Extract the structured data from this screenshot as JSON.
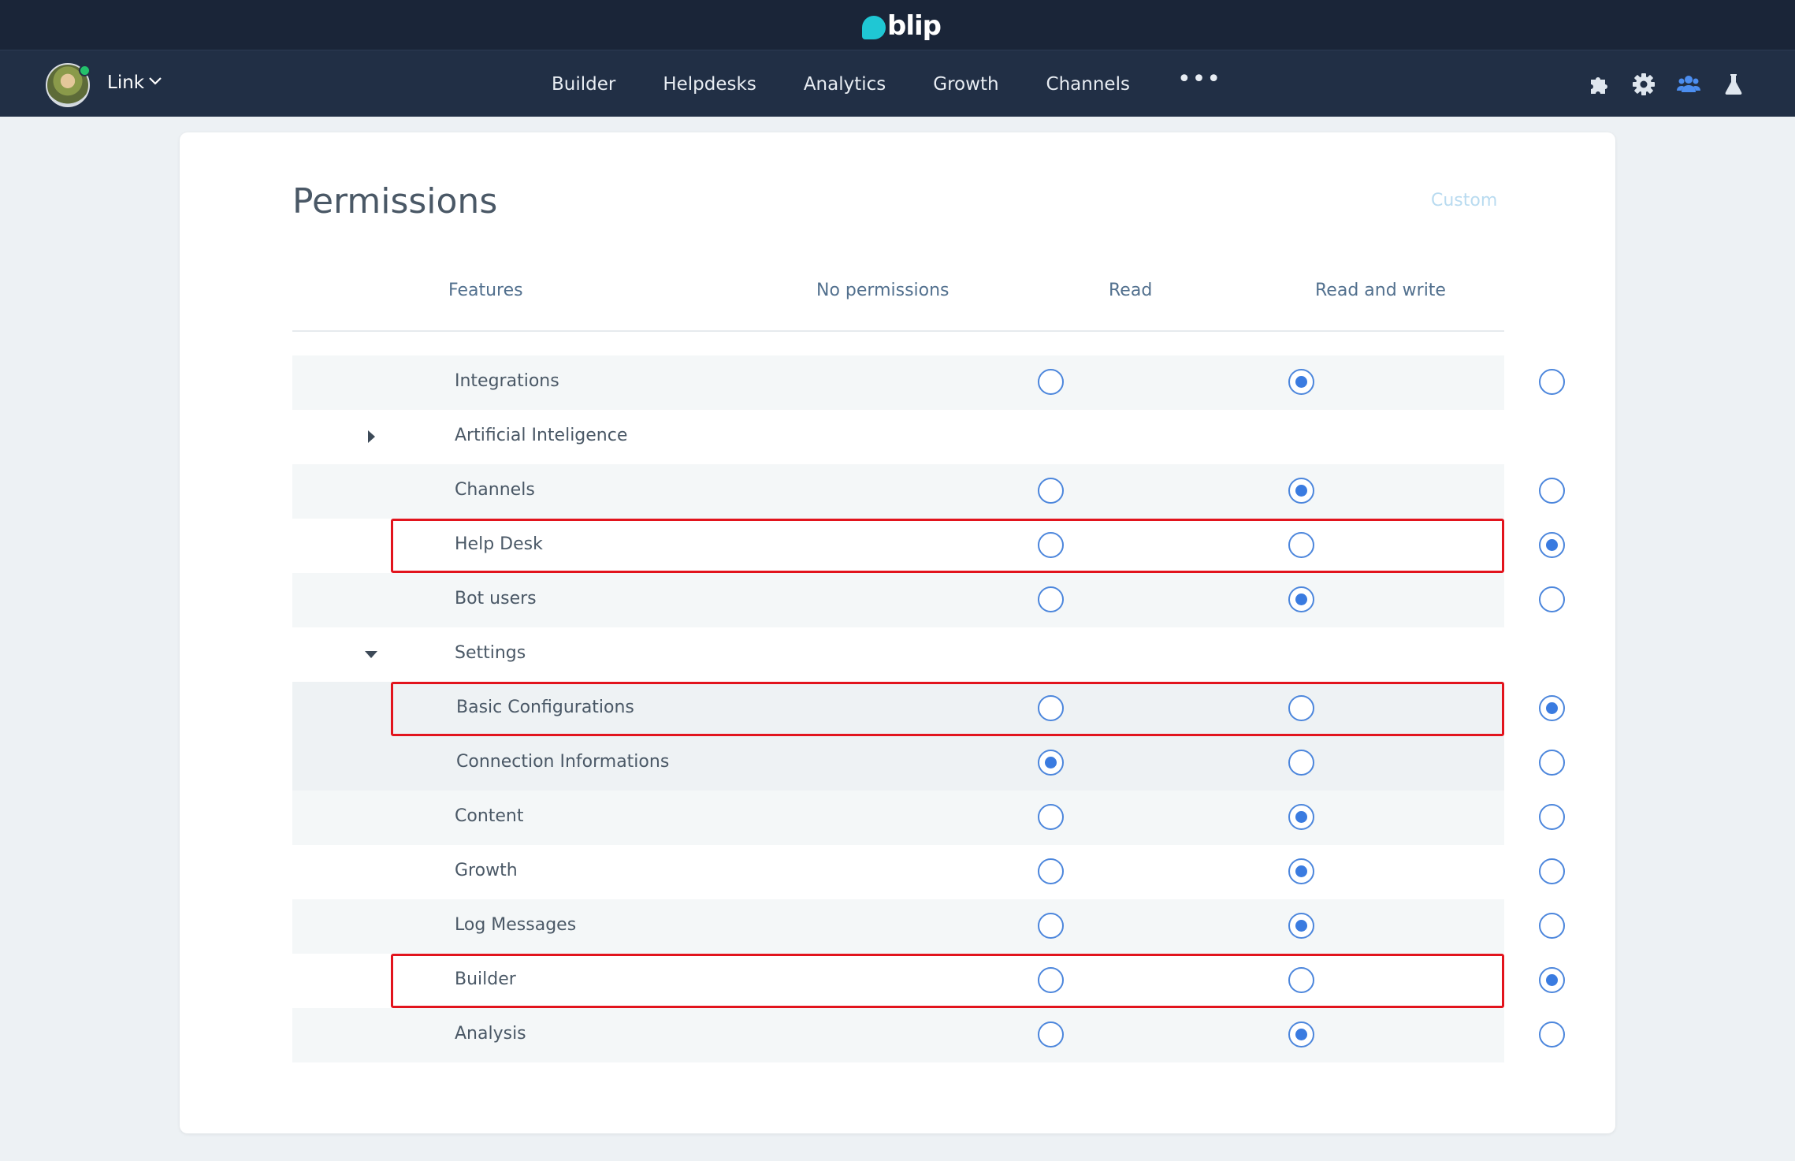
{
  "brand": {
    "name": "blip"
  },
  "user": {
    "name": "Link"
  },
  "nav": {
    "links": [
      "Builder",
      "Helpdesks",
      "Analytics",
      "Growth",
      "Channels"
    ],
    "more": "•••",
    "icons": [
      "puzzle-icon",
      "gear-icon",
      "team-icon",
      "flask-icon"
    ],
    "active_icon": "team-icon"
  },
  "colors": {
    "accent": "#3a7be0",
    "highlight": "#e2141d",
    "brandbar": "#1a2538",
    "navbar": "#212f45",
    "logo": "#1fc7d4"
  },
  "page": {
    "title": "Permissions",
    "mode": "Custom"
  },
  "table": {
    "headers": [
      "Features",
      "No permissions",
      "Read",
      "Read and write"
    ],
    "rows": [
      {
        "label": "Integrations",
        "level": 1,
        "shade": "shade",
        "selected": 1
      },
      {
        "label": "Artificial Inteligence",
        "level": 0,
        "shade": "",
        "toggle": "collapsed"
      },
      {
        "label": "Channels",
        "level": 1,
        "shade": "shade",
        "selected": 1
      },
      {
        "label": "Help Desk",
        "level": 1,
        "shade": "",
        "selected": 2,
        "highlighted": true
      },
      {
        "label": "Bot users",
        "level": 1,
        "shade": "shade",
        "selected": 1
      },
      {
        "label": "Settings",
        "level": 0,
        "shade": "",
        "toggle": "expanded"
      },
      {
        "label": "Basic Configurations",
        "level": 2,
        "shade": "sub",
        "selected": 2,
        "highlighted": true
      },
      {
        "label": "Connection Informations",
        "level": 2,
        "shade": "sub",
        "selected": 0
      },
      {
        "label": "Content",
        "level": 1,
        "shade": "shade",
        "selected": 1
      },
      {
        "label": "Growth",
        "level": 1,
        "shade": "",
        "selected": 1
      },
      {
        "label": "Log Messages",
        "level": 1,
        "shade": "shade",
        "selected": 1
      },
      {
        "label": "Builder",
        "level": 1,
        "shade": "",
        "selected": 2,
        "highlighted": true
      },
      {
        "label": "Analysis",
        "level": 1,
        "shade": "shade",
        "selected": 1
      }
    ]
  }
}
